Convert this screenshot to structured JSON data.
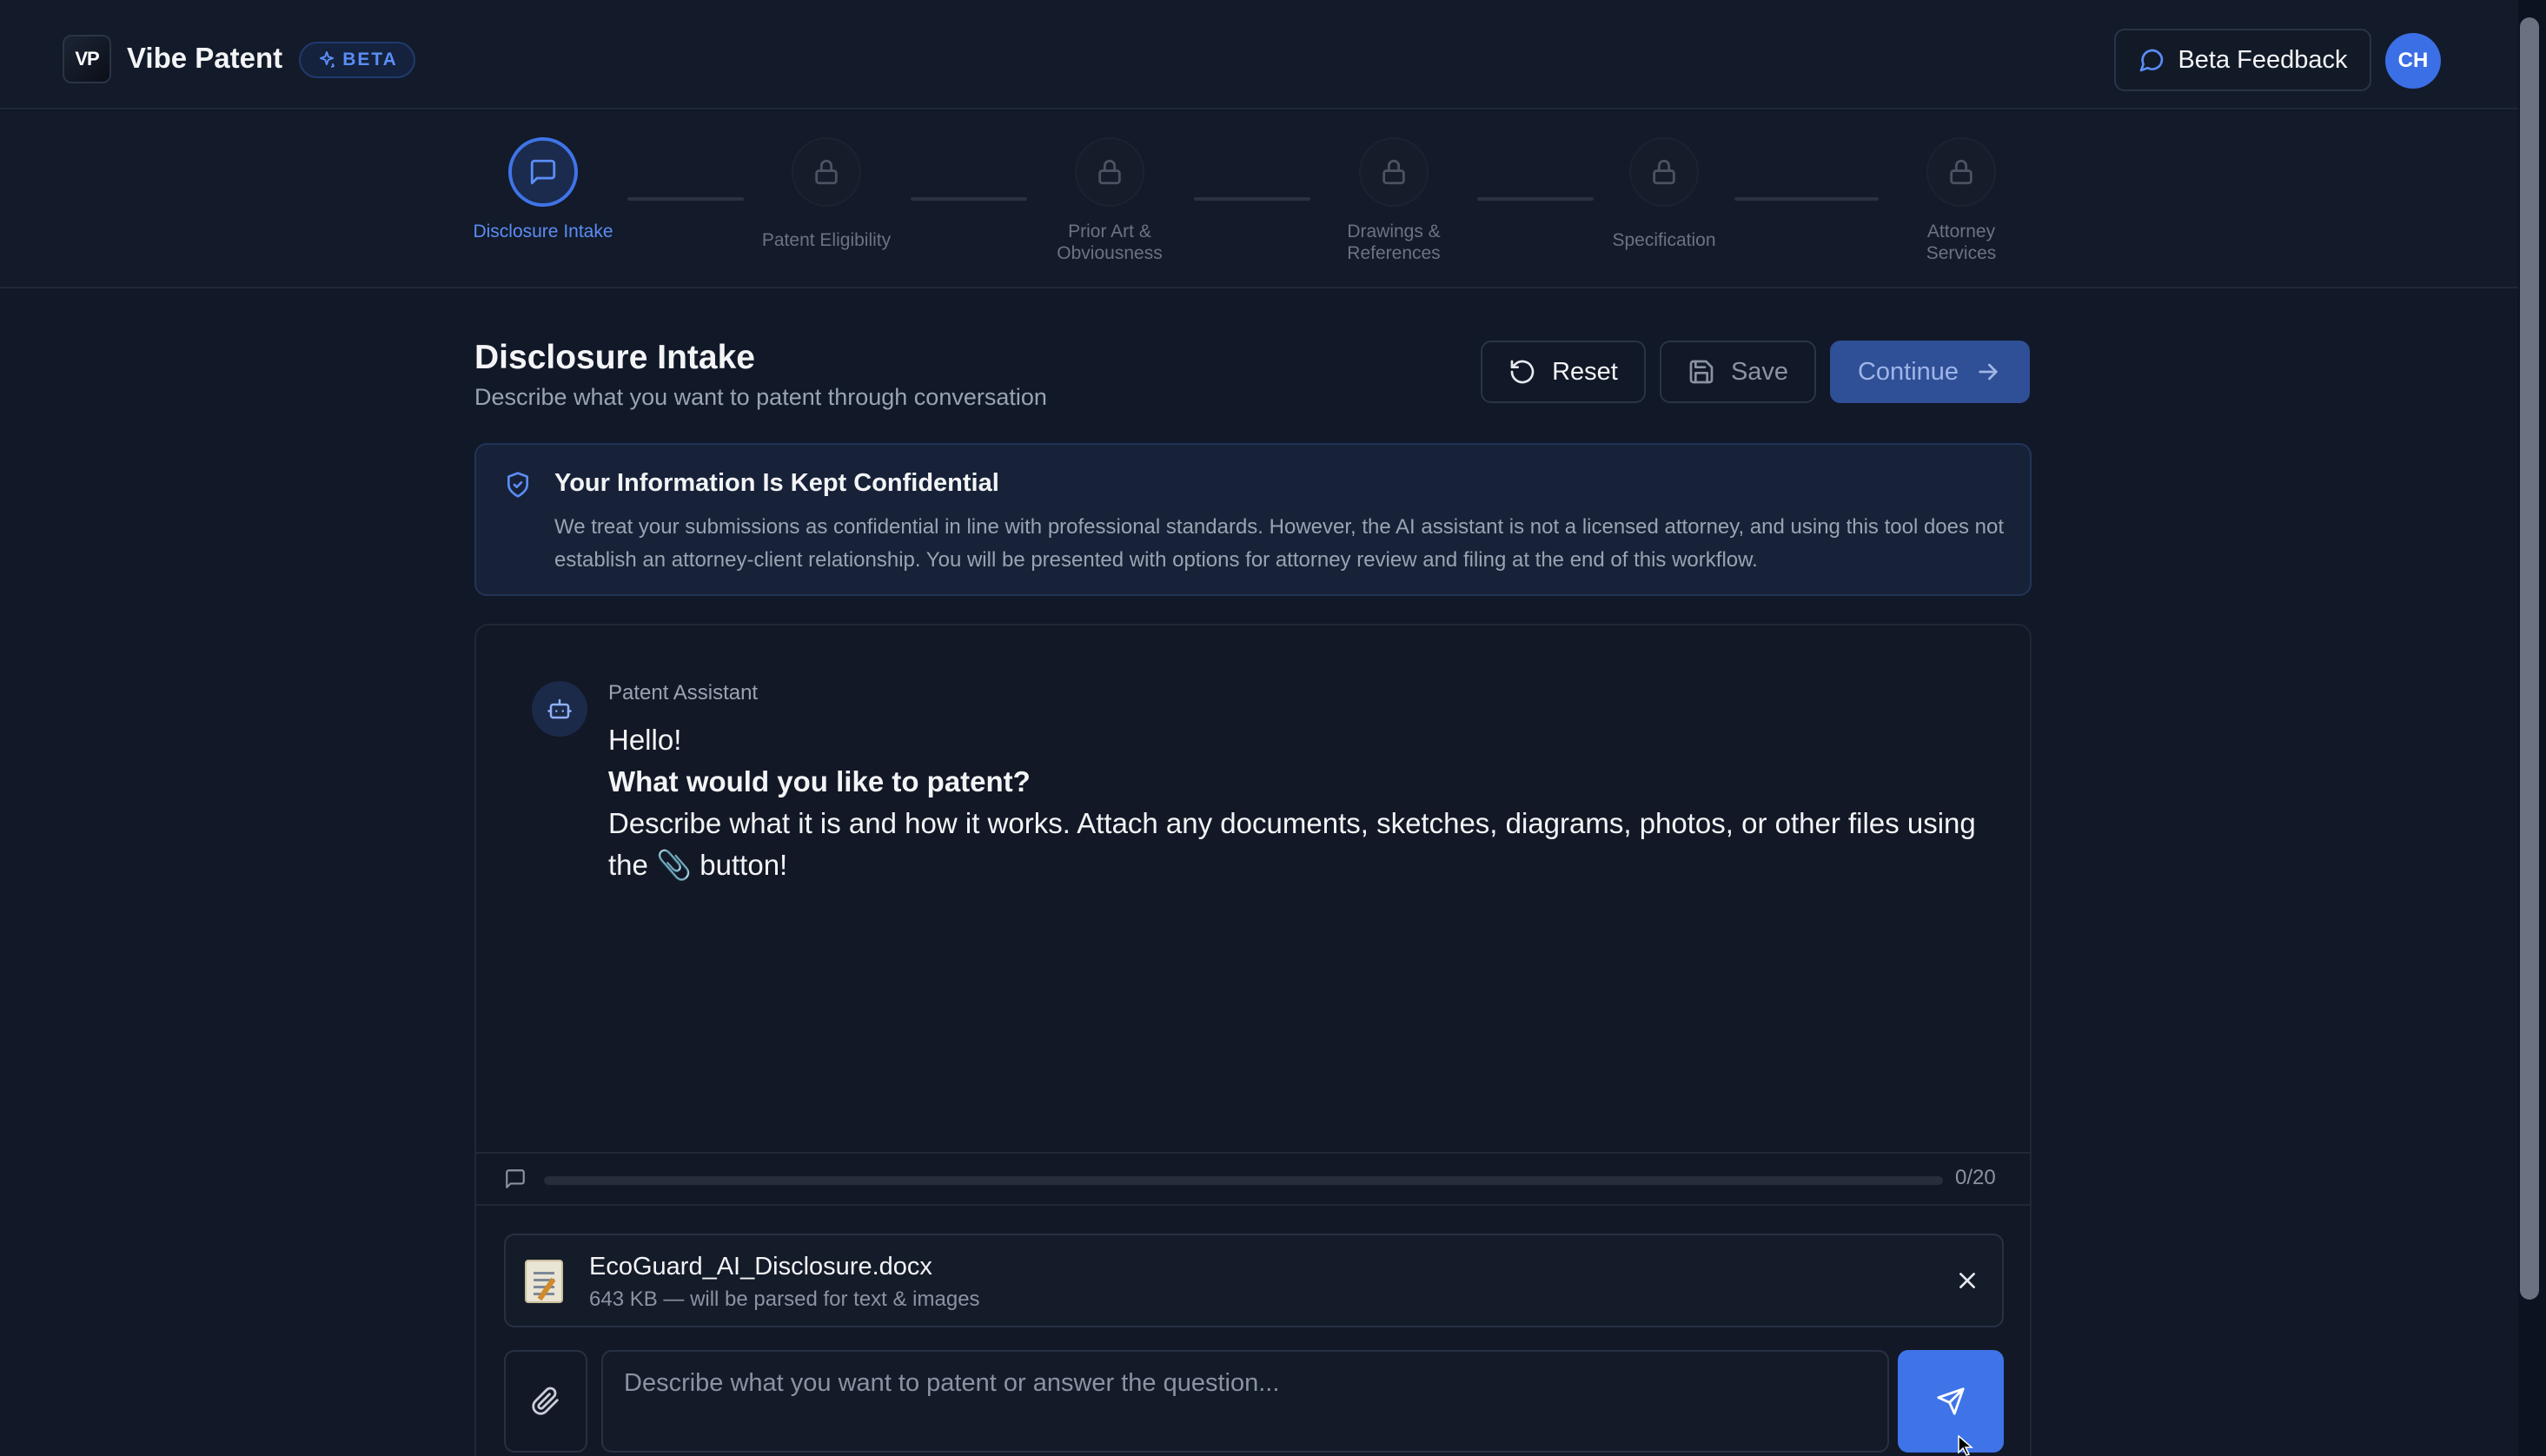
{
  "header": {
    "logo_text": "VP",
    "app_title": "Vibe Patent",
    "beta_label": "BETA",
    "feedback_label": "Beta Feedback",
    "avatar_initials": "CH"
  },
  "stepper": {
    "steps": [
      {
        "label": "Disclosure Intake",
        "state": "active",
        "icon": "message-square-icon"
      },
      {
        "label": "Patent Eligibility",
        "state": "locked",
        "icon": "lock-icon"
      },
      {
        "label": "Prior Art & Obviousness",
        "state": "locked",
        "icon": "lock-icon"
      },
      {
        "label": "Drawings & References",
        "state": "locked",
        "icon": "lock-icon"
      },
      {
        "label": "Specification",
        "state": "locked",
        "icon": "lock-icon"
      },
      {
        "label": "Attorney Services",
        "state": "locked",
        "icon": "lock-icon"
      }
    ]
  },
  "page": {
    "title": "Disclosure Intake",
    "subtitle": "Describe what you want to patent through conversation",
    "reset_label": "Reset",
    "save_label": "Save",
    "continue_label": "Continue"
  },
  "notice": {
    "title": "Your Information Is Kept Confidential",
    "body": "We treat your submissions as confidential in line with professional standards. However, the AI assistant is not a licensed attorney, and using this tool does not establish an attorney-client relationship. You will be presented with options for attorney review and filing at the end of this workflow."
  },
  "chat": {
    "sender": "Patent Assistant",
    "greeting": "Hello!",
    "question": "What would you like to patent?",
    "instruction_before": "Describe what it is and how it works. Attach any documents, sketches, diagrams, photos, or other files using the ",
    "instruction_emoji": "📎",
    "instruction_after": " button!"
  },
  "progress": {
    "count_label": "0/20",
    "current": 0,
    "total": 20
  },
  "attachment": {
    "file_name": "EcoGuard_AI_Disclosure.docx",
    "meta": "643 KB — will be parsed for text & images"
  },
  "composer": {
    "placeholder": "Describe what you want to patent or answer the question...",
    "value": ""
  },
  "colors": {
    "accent": "#3f74e8",
    "background": "#111827"
  }
}
